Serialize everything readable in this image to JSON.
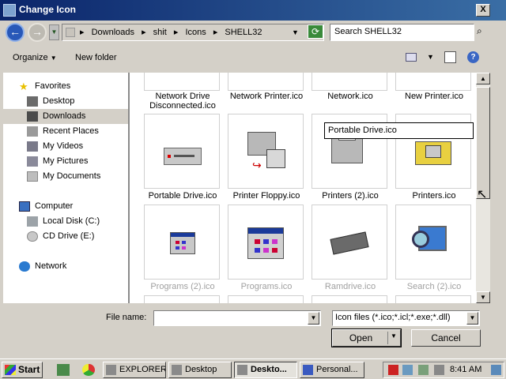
{
  "window": {
    "title": "Change Icon",
    "close_label": "X"
  },
  "address": {
    "crumbs": [
      "Downloads",
      "shit",
      "Icons",
      "SHELL32"
    ],
    "separator": "▸"
  },
  "search": {
    "placeholder": "Search SHELL32"
  },
  "toolbar": {
    "organize": "Organize",
    "new_folder": "New folder"
  },
  "navpane": {
    "favorites": {
      "label": "Favorites",
      "items": [
        {
          "label": "Desktop"
        },
        {
          "label": "Downloads",
          "selected": true
        },
        {
          "label": "Recent Places"
        }
      ]
    },
    "libraries": [
      {
        "label": "My Videos"
      },
      {
        "label": "My Pictures"
      },
      {
        "label": "My Documents"
      }
    ],
    "computer": {
      "label": "Computer",
      "items": [
        {
          "label": "Local Disk (C:)"
        },
        {
          "label": "CD Drive (E:)"
        }
      ]
    },
    "network": {
      "label": "Network"
    }
  },
  "files": {
    "row0": [
      "Network Drive Disconnected.ico",
      "Network Printer.ico",
      "Network.ico",
      "New Printer.ico"
    ],
    "row1": [
      "Portable Drive.ico",
      "Printer Floppy.ico",
      "Printers (2).ico",
      "Printers.ico"
    ],
    "row2": [
      "Programs (2).ico",
      "Programs.ico",
      "Ramdrive.ico",
      "Search (2).ico"
    ]
  },
  "tooltip": "Portable Drive.ico",
  "footer": {
    "file_name_label": "File name:",
    "file_name_value": "",
    "filter": "Icon files (*.ico;*.icl;*.exe;*.dll)",
    "open": "Open",
    "cancel": "Cancel"
  },
  "taskbar": {
    "start": "Start",
    "tasks": [
      {
        "label": "EXPLORER"
      },
      {
        "label": "Desktop"
      },
      {
        "label": "Deskto...",
        "active": true
      },
      {
        "label": "Personal..."
      }
    ],
    "clock": "8:41 AM"
  },
  "colors": {
    "titlebar": "#0a246a",
    "face": "#d4d0c8",
    "selection": "#d4d0c8"
  }
}
